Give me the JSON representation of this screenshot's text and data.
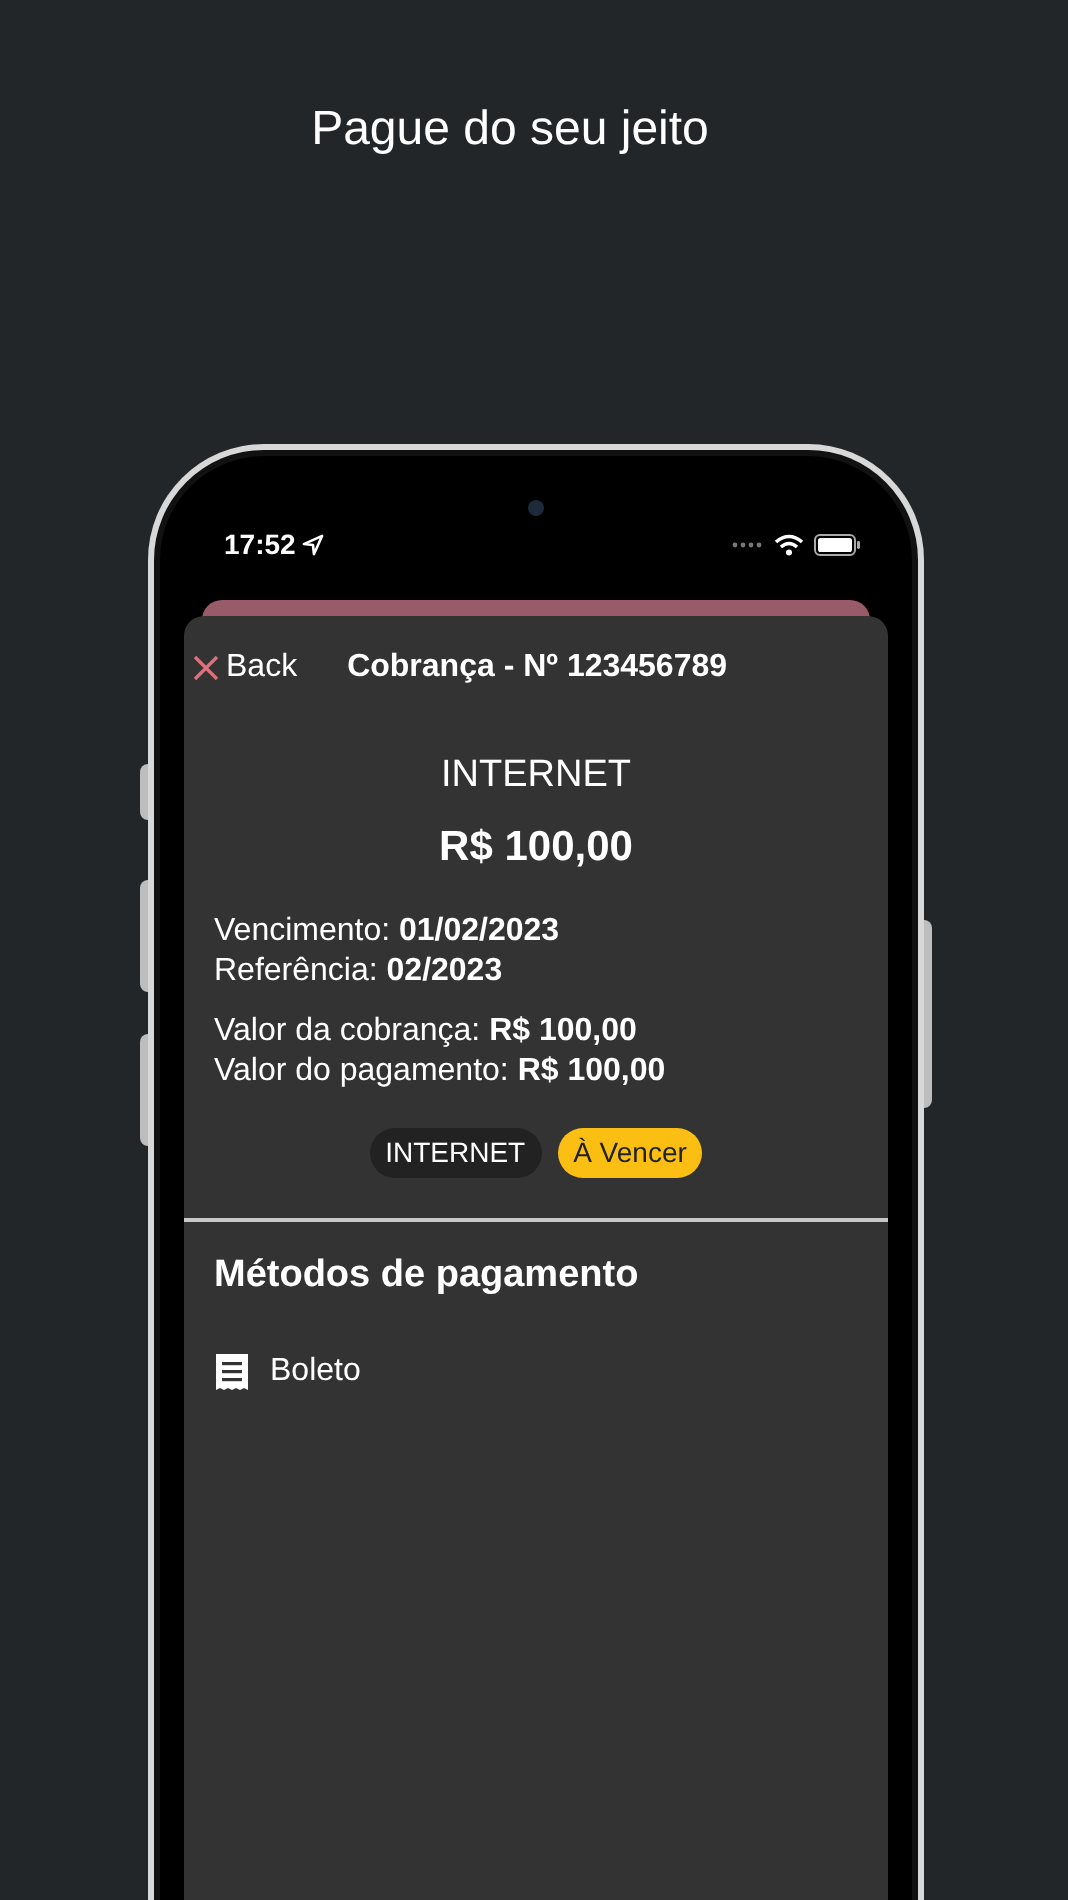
{
  "headline": "Pague do seu jeito",
  "status_bar": {
    "time": "17:52"
  },
  "nav": {
    "back_label": "Back",
    "title": "Cobrança - Nº 123456789"
  },
  "bill": {
    "category": "INTERNET",
    "amount": "R$ 100,00",
    "detail_groups": [
      [
        "Vencimento: **01/02/2023**",
        "Referência: **02/2023**"
      ],
      [
        "Valor da cobrança: **R$ 100,00**",
        "Valor do pagamento: **R$ 100,00**"
      ]
    ],
    "tags": [
      {
        "label": "INTERNET",
        "kind": "category"
      },
      {
        "label": "À Vencer",
        "kind": "status"
      }
    ]
  },
  "payment_methods": {
    "title": "Métodos de pagamento",
    "items": [
      {
        "label": "Boleto"
      }
    ]
  }
}
